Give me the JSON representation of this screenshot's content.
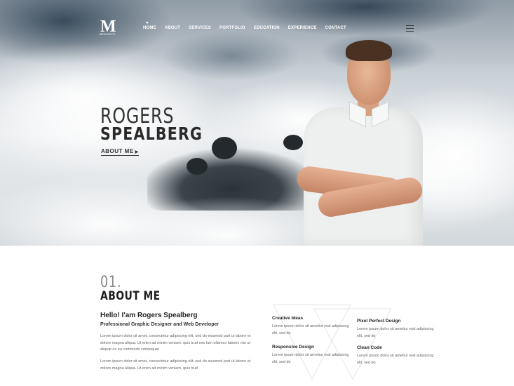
{
  "nav": {
    "logo_letter": "M",
    "logo_sub": "MEMORYS",
    "items": [
      "HOME",
      "ABOUT",
      "SERVICES",
      "PORTFOLIO",
      "EDUCATION",
      "EXPERIENCE",
      "CONTACT"
    ]
  },
  "hero": {
    "first_name": "ROGERS",
    "last_name": "SPEALBERG",
    "cta": "ABOUT ME"
  },
  "about": {
    "number": "01.",
    "title": "ABOUT ME",
    "hello": "Hello! I'am Rogers Spealberg",
    "role": "Professional Graphic Designer and Web Developer",
    "para1": "Lorem ipsum dolor sit amet, consectetur adipiscing elit, sed do eiusmod part ut labore et dolore magna aliqua. Ut enim ad minim veniam, quis trud exe lum ullamco laboris nisi ut aliquip ex ea commodo consequat",
    "para2": "Lorem ipsum dolor sit amet, consectetur adipiscing elit, sed do eiusmod part ut labore et dolore magna aliqua. Ut enim ad minim veniam, quis trud",
    "features": [
      {
        "title": "Creative Ideas",
        "text": "Lorem ipsum dolor sit amettur real adipiscing elit, sed do"
      },
      {
        "title": "Pixel Perfect Design",
        "text": "Lorem ipsum dolor sit amettur real adipiscing elit, sed do"
      },
      {
        "title": "Responsive Design",
        "text": "Lorem ipsum dolor sit amettur real adipiscing elit, sed do"
      },
      {
        "title": "Clean Code",
        "text": "Lorem ipsum dolor sit amettur real adipiscing elit, sed do"
      }
    ]
  }
}
